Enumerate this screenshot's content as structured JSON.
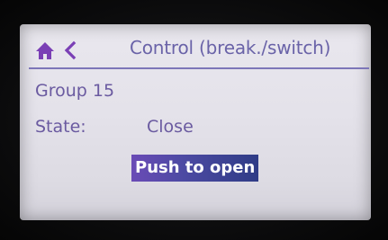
{
  "header": {
    "title": "Control (break./switch)",
    "home_icon": "home-icon",
    "back_icon": "chevron-left-icon"
  },
  "group": {
    "label": "Group 15"
  },
  "state": {
    "label": "State:",
    "value": "Close"
  },
  "action": {
    "label": "Push to open"
  },
  "colors": {
    "accent": "#6a63a8",
    "text": "#6a5aa0",
    "button_bg": "#4d4aa3",
    "screen_bg": "#e6e4ec"
  }
}
